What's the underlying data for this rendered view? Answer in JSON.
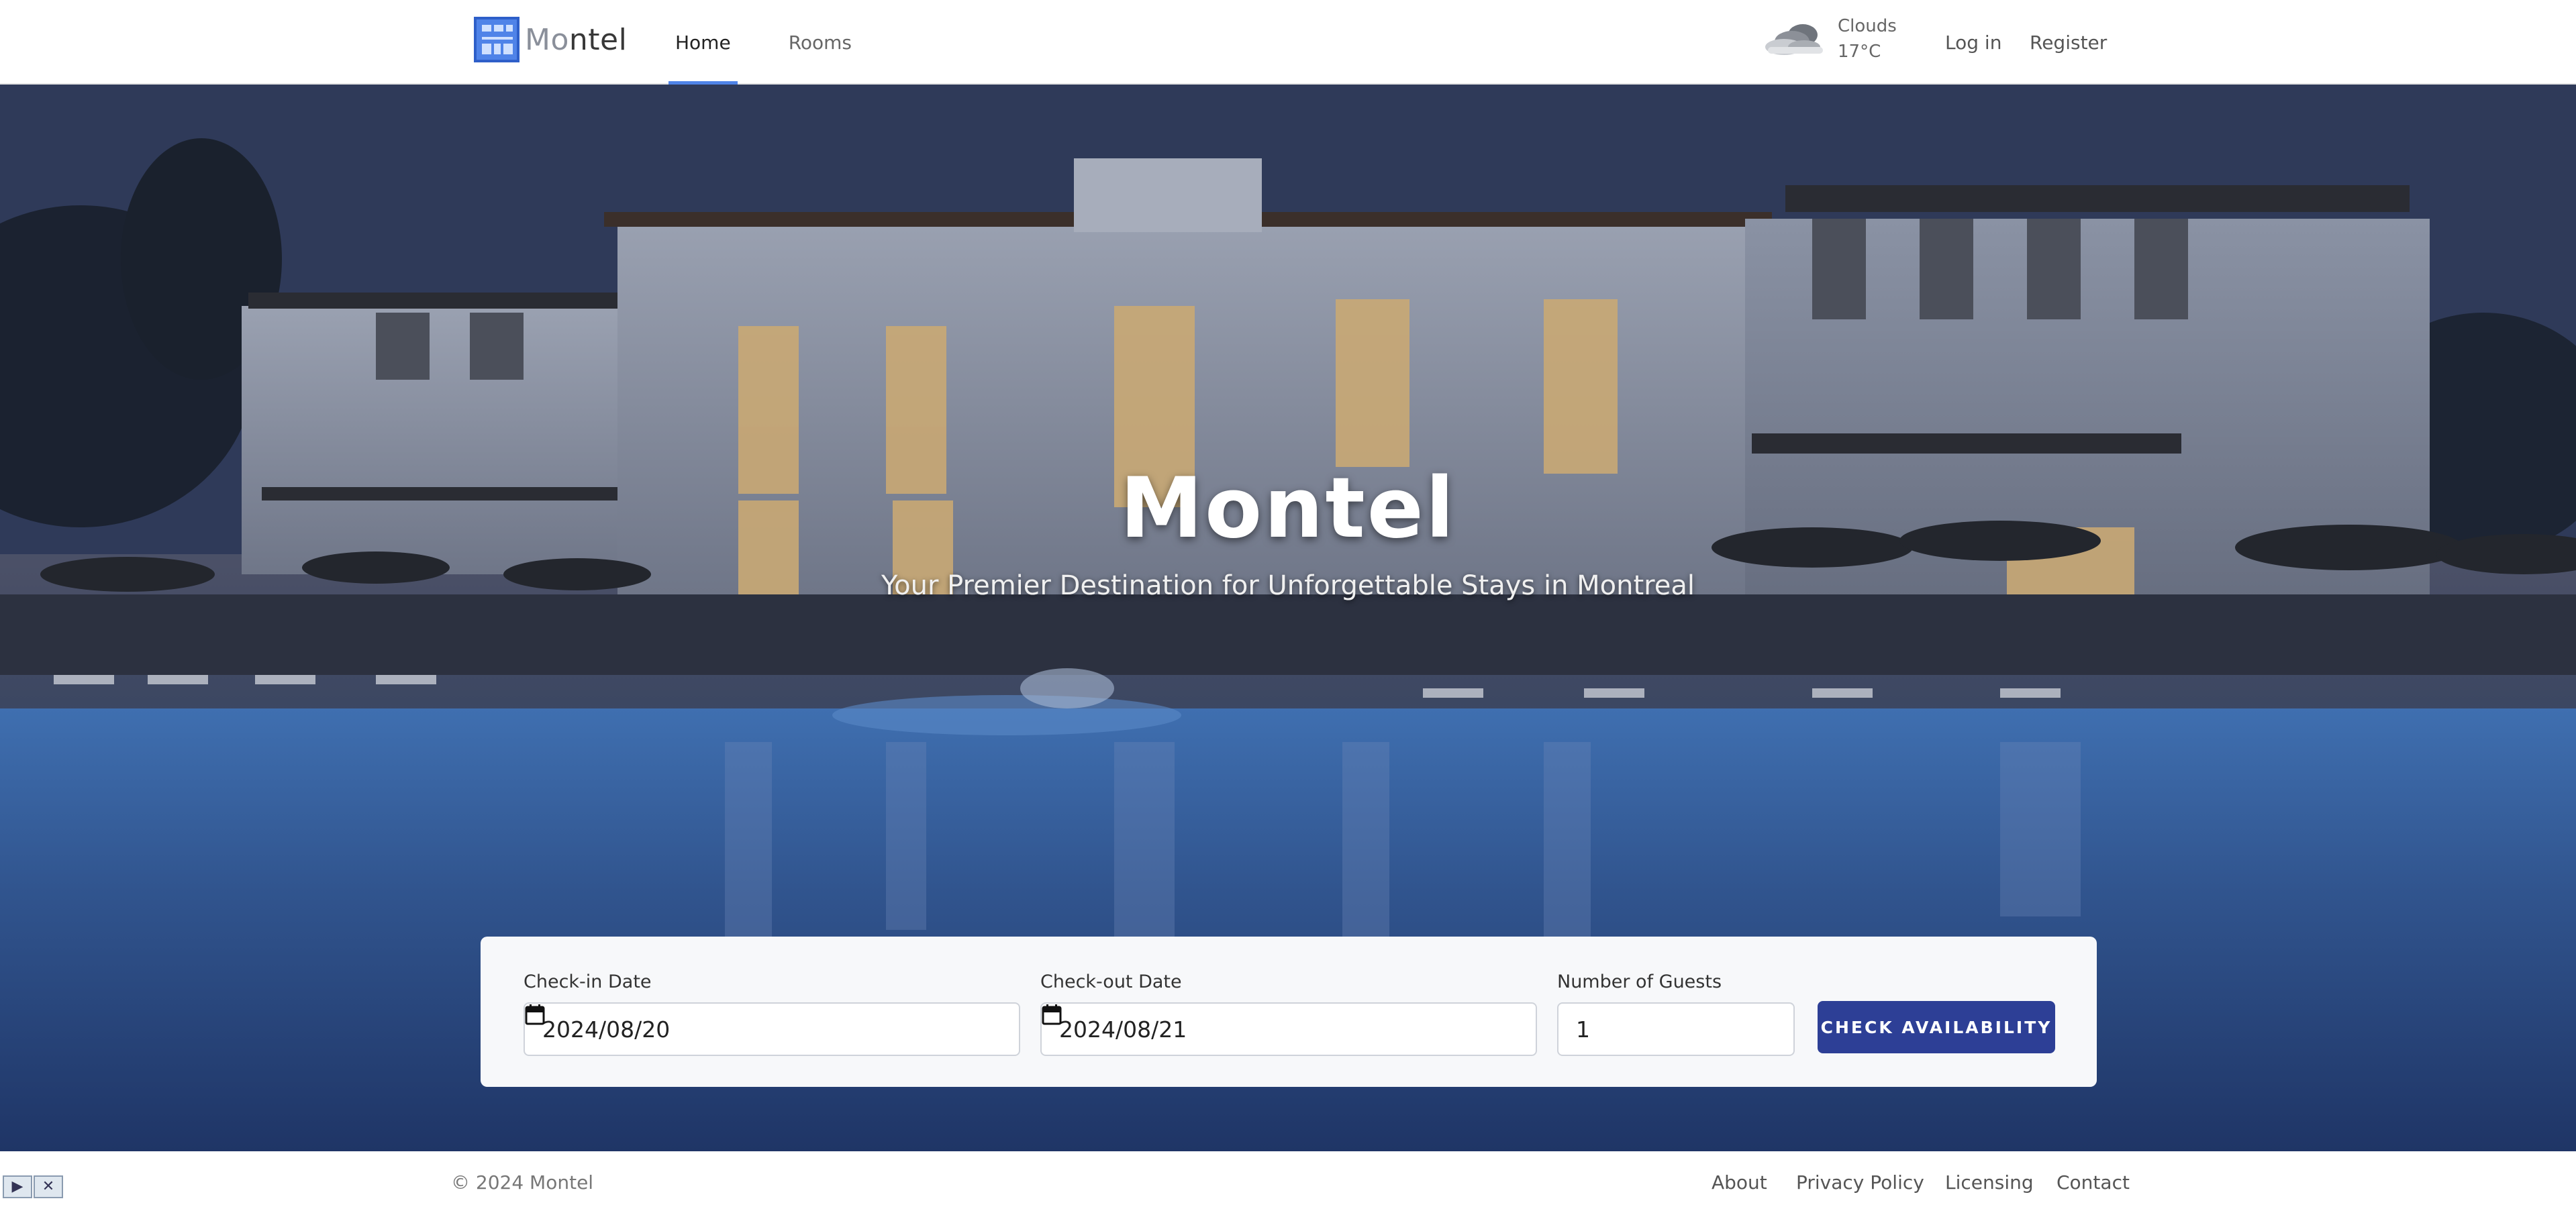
{
  "header": {
    "logo_text_a": "Mo",
    "logo_text_b": "ntel",
    "nav": [
      {
        "label": "Home",
        "active": true
      },
      {
        "label": "Rooms",
        "active": false
      }
    ],
    "weather": {
      "condition": "Clouds",
      "temperature": "17°C",
      "icon": "cloud-icon"
    },
    "login_label": "Log in",
    "register_label": "Register"
  },
  "hero": {
    "title": "Montel",
    "subtitle": "Your Premier Destination for Unforgettable Stays in Montreal"
  },
  "booking": {
    "checkin": {
      "label": "Check-in Date",
      "value": "2024/08/20"
    },
    "checkout": {
      "label": "Check-out Date",
      "value": "2024/08/21"
    },
    "guests": {
      "label": "Number of Guests",
      "value": "1"
    },
    "submit_label": "CHECK AVAILABILITY"
  },
  "footer": {
    "copyright": "© 2024 Montel",
    "links": [
      "About",
      "Privacy Policy",
      "Licensing",
      "Contact"
    ],
    "player_icons": [
      "play-icon",
      "close-icon"
    ]
  },
  "colors": {
    "accent": "#4f83e8",
    "button": "#2d3f96"
  }
}
